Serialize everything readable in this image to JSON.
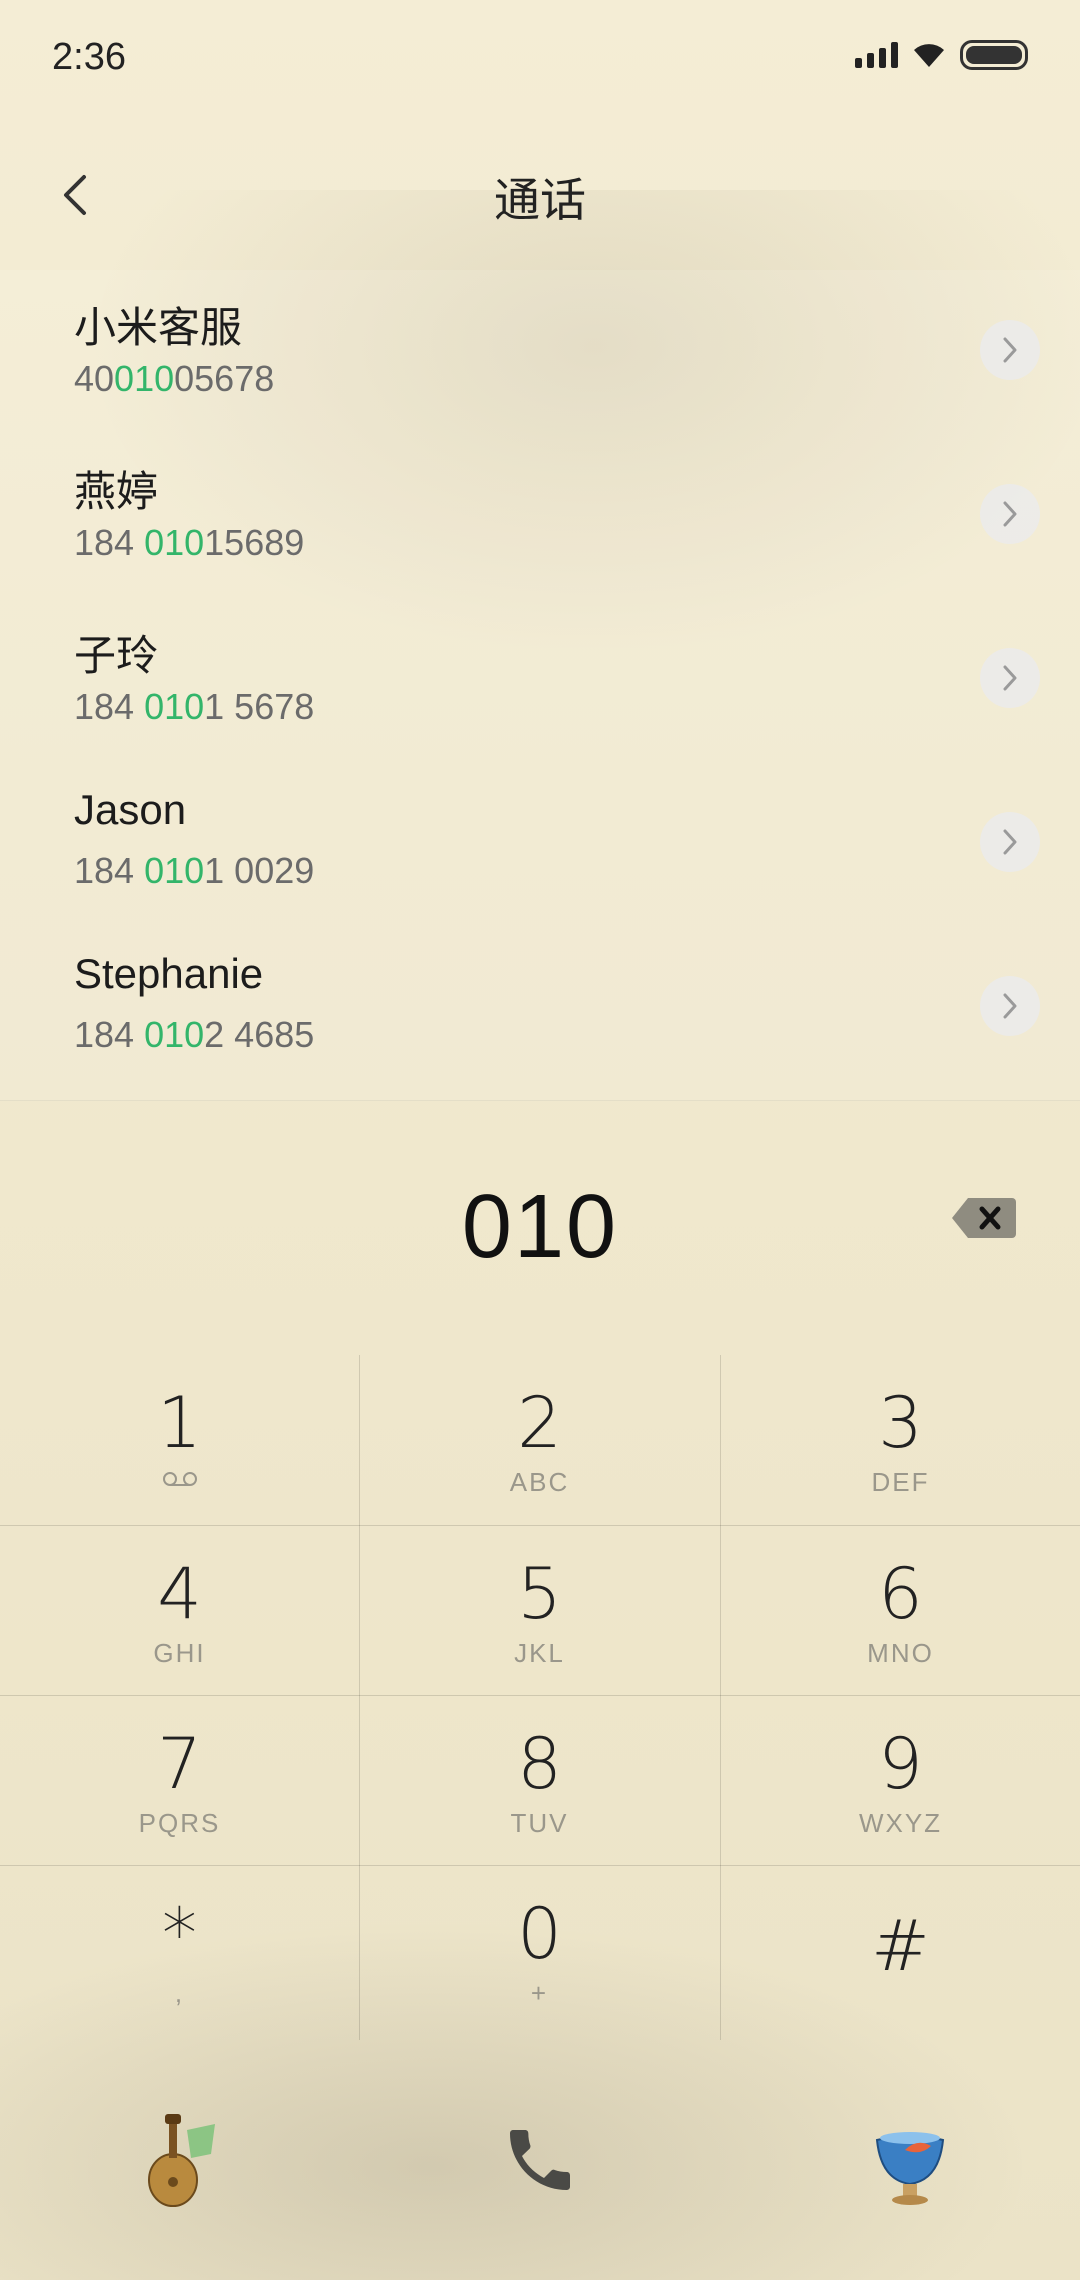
{
  "status_bar": {
    "time": "2:36"
  },
  "header": {
    "title": "通话"
  },
  "contacts": [
    {
      "name": "小米客服",
      "num_pre": "40",
      "num_hl": "010",
      "num_post": "05678"
    },
    {
      "name": "燕婷",
      "num_pre": "184 ",
      "num_hl": "010",
      "num_post": "15689"
    },
    {
      "name": "子玲",
      "num_pre": "184 ",
      "num_hl": "010",
      "num_post": "1 5678"
    },
    {
      "name": "Jason",
      "num_pre": "184 ",
      "num_hl": "010",
      "num_post": "1 0029"
    },
    {
      "name": "Stephanie",
      "num_pre": "184 ",
      "num_hl": "010",
      "num_post": "2 4685"
    }
  ],
  "dialer": {
    "input": "010"
  },
  "keys": [
    {
      "digit": "1",
      "letters": ""
    },
    {
      "digit": "2",
      "letters": "ABC"
    },
    {
      "digit": "3",
      "letters": "DEF"
    },
    {
      "digit": "4",
      "letters": "GHI"
    },
    {
      "digit": "5",
      "letters": "JKL"
    },
    {
      "digit": "6",
      "letters": "MNO"
    },
    {
      "digit": "7",
      "letters": "PQRS"
    },
    {
      "digit": "8",
      "letters": "TUV"
    },
    {
      "digit": "9",
      "letters": "WXYZ"
    },
    {
      "digit": "*",
      "letters": ","
    },
    {
      "digit": "0",
      "letters": "+"
    },
    {
      "digit": "#",
      "letters": ""
    }
  ],
  "icons": {
    "voicemail": "voicemail-icon",
    "left_button": "pipa-instrument-icon",
    "call": "phone-call-icon",
    "right_button": "fish-bowl-icon"
  },
  "colors": {
    "highlight": "#33b56a",
    "background": "#f2ebd2"
  }
}
